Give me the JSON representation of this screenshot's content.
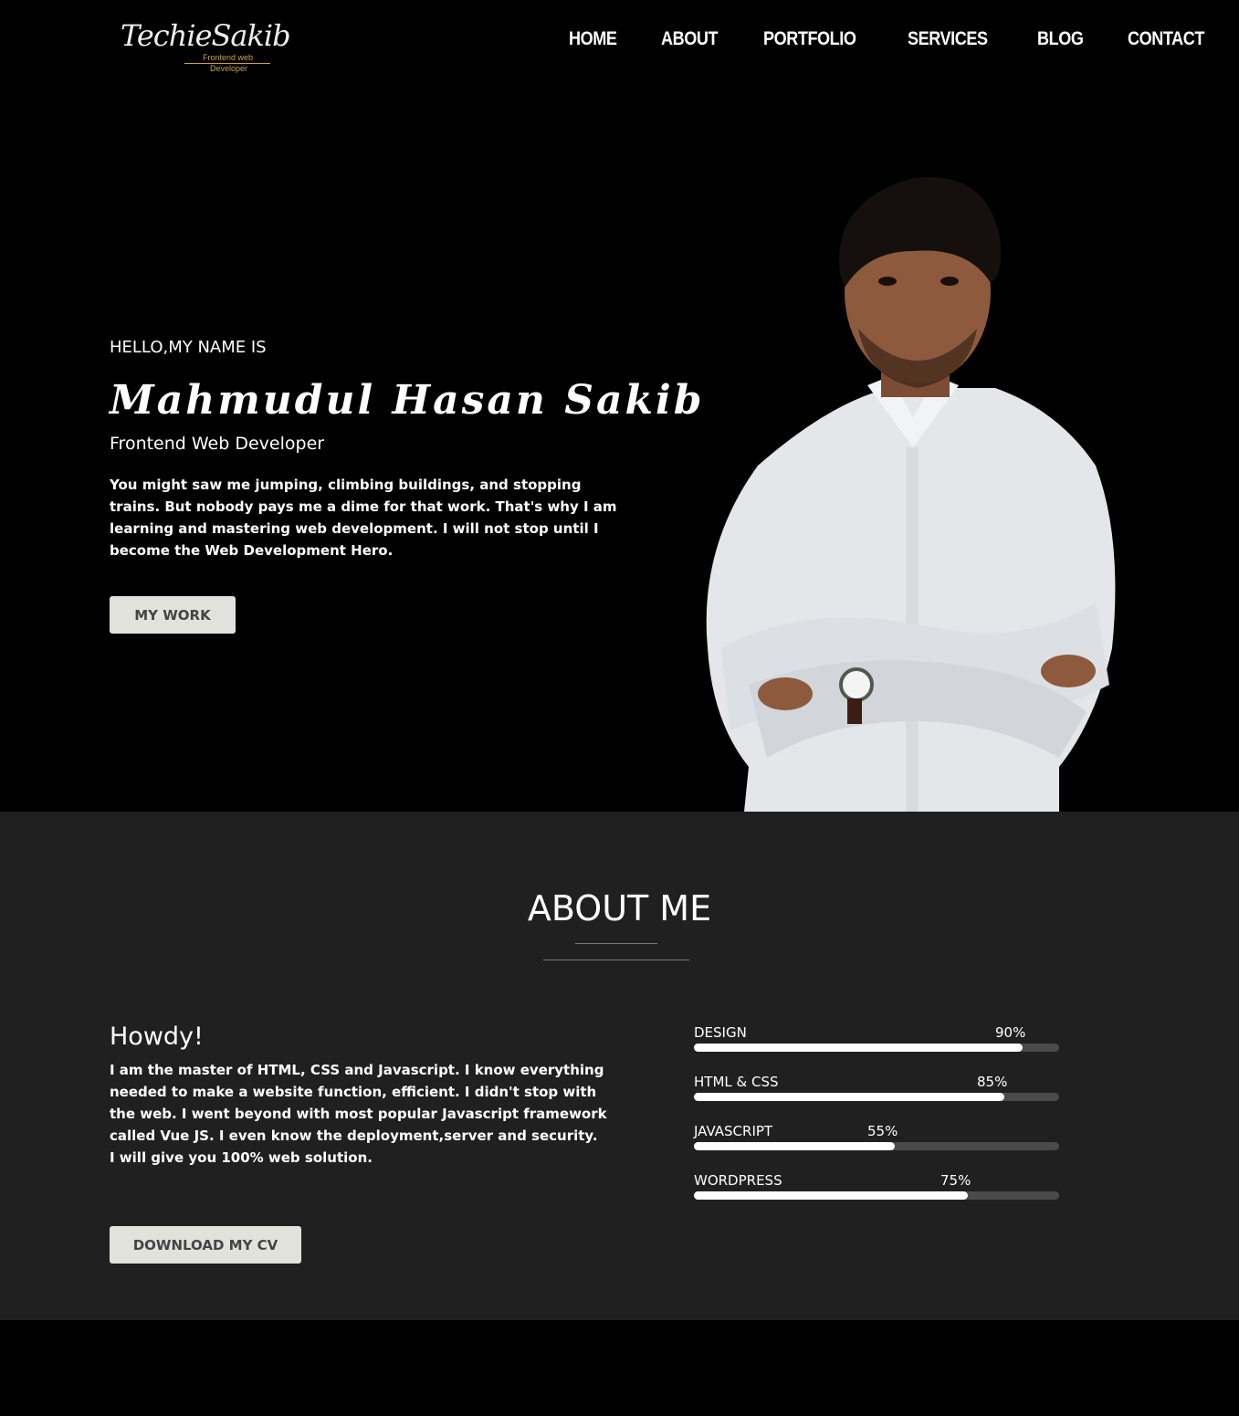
{
  "header": {
    "logo": {
      "script": "TechieSakib",
      "sub1": "Frontend web",
      "sub2": "Developer"
    },
    "nav": [
      {
        "label": "HOME",
        "key": "home"
      },
      {
        "label": "ABOUT",
        "key": "about"
      },
      {
        "label": "PORTFOLIO",
        "key": "portfolio"
      },
      {
        "label": "SERVICES",
        "key": "services"
      },
      {
        "label": "BLOG",
        "key": "blog"
      },
      {
        "label": "CONTACT",
        "key": "contact"
      }
    ]
  },
  "hero": {
    "greeting": "HELLO,MY NAME IS",
    "name": "Mahmudul Hasan Sakib",
    "role": "Frontend Web Developer",
    "bio": "You might saw me jumping, climbing buildings, and stopping trains. But nobody pays me a dime for that work. That's why I am learning and mastering web development. I will not stop until I become the Web Development Hero.",
    "button": "MY WORK"
  },
  "about": {
    "title": "ABOUT ME",
    "heading": "Howdy!",
    "text": "I am the master of HTML, CSS and Javascript. I know everything needed to make a website function, efficient. I didn't stop with the web. I went beyond with most popular Javascript framework called Vue JS. I even know the deployment,server and security. I will give you 100% web solution.",
    "button": "DOWNLOAD MY CV",
    "skills": [
      {
        "name": "DESIGN",
        "percent_label": "90%",
        "percent": 90
      },
      {
        "name": "HTML & CSS",
        "percent_label": "85%",
        "percent": 85
      },
      {
        "name": "JAVASCRIPT",
        "percent_label": "55%",
        "percent": 55
      },
      {
        "name": "WORDPRESS",
        "percent_label": "75%",
        "percent": 75
      }
    ]
  },
  "colors": {
    "background": "#000000",
    "about_background": "#202020",
    "button_bg": "#e1e2dc",
    "button_text": "#444444",
    "accent_gold": "#c9a24a",
    "bar_track": "#4a4a4a",
    "bar_fill": "#ffffff"
  }
}
